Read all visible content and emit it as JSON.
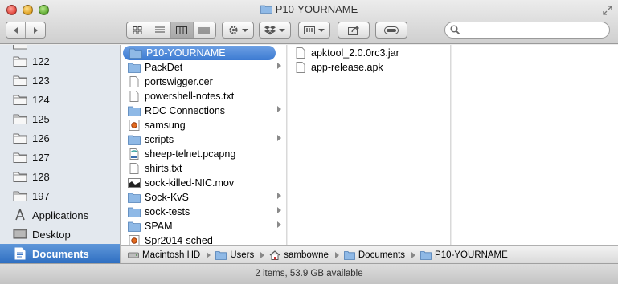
{
  "window": {
    "title": "P10-YOURNAME"
  },
  "toolbar": {
    "back_label": "◀",
    "forward_label": "▶",
    "search_placeholder": ""
  },
  "sidebar": {
    "items": [
      {
        "label": "122",
        "icon": "folder-icon"
      },
      {
        "label": "123",
        "icon": "folder-icon"
      },
      {
        "label": "124",
        "icon": "folder-icon"
      },
      {
        "label": "125",
        "icon": "folder-icon"
      },
      {
        "label": "126",
        "icon": "folder-icon"
      },
      {
        "label": "127",
        "icon": "folder-icon"
      },
      {
        "label": "128",
        "icon": "folder-icon"
      },
      {
        "label": "197",
        "icon": "folder-icon"
      },
      {
        "label": "Applications",
        "icon": "applications-icon"
      },
      {
        "label": "Desktop",
        "icon": "desktop-icon"
      },
      {
        "label": "Documents",
        "icon": "documents-icon",
        "selected": true
      }
    ]
  },
  "column1": {
    "items": [
      {
        "name": "P10-YOURNAME",
        "kind": "folder",
        "selected": true,
        "arrow": true
      },
      {
        "name": "PackDet",
        "kind": "folder",
        "arrow": true
      },
      {
        "name": "portswigger.cer",
        "kind": "file"
      },
      {
        "name": "powershell-notes.txt",
        "kind": "file"
      },
      {
        "name": "RDC Connections",
        "kind": "folder",
        "arrow": true
      },
      {
        "name": "samsung",
        "kind": "app"
      },
      {
        "name": "scripts",
        "kind": "folder",
        "arrow": true
      },
      {
        "name": "sheep-telnet.pcapng",
        "kind": "pcap"
      },
      {
        "name": "shirts.txt",
        "kind": "file"
      },
      {
        "name": "sock-killed-NIC.mov",
        "kind": "movie"
      },
      {
        "name": "Sock-KvS",
        "kind": "folder",
        "arrow": true
      },
      {
        "name": "sock-tests",
        "kind": "folder",
        "arrow": true
      },
      {
        "name": "SPAM",
        "kind": "folder",
        "arrow": true
      },
      {
        "name": "Spr2014-sched",
        "kind": "app"
      }
    ]
  },
  "column2": {
    "items": [
      {
        "name": "apktool_2.0.0rc3.jar",
        "kind": "file"
      },
      {
        "name": "app-release.apk",
        "kind": "file"
      }
    ]
  },
  "pathbar": {
    "crumbs": [
      {
        "label": "Macintosh HD",
        "icon": "hard-drive-icon"
      },
      {
        "label": "Users",
        "icon": "folder-icon"
      },
      {
        "label": "sambowne",
        "icon": "home-icon"
      },
      {
        "label": "Documents",
        "icon": "folder-icon"
      },
      {
        "label": "P10-YOURNAME",
        "icon": "folder-icon"
      }
    ]
  },
  "status": {
    "text": "2 items, 53.9 GB available"
  },
  "colors": {
    "selection": "#3c7ad2",
    "sidebar_bg": "#e3e8ee",
    "folder": "#8fb9e6"
  }
}
